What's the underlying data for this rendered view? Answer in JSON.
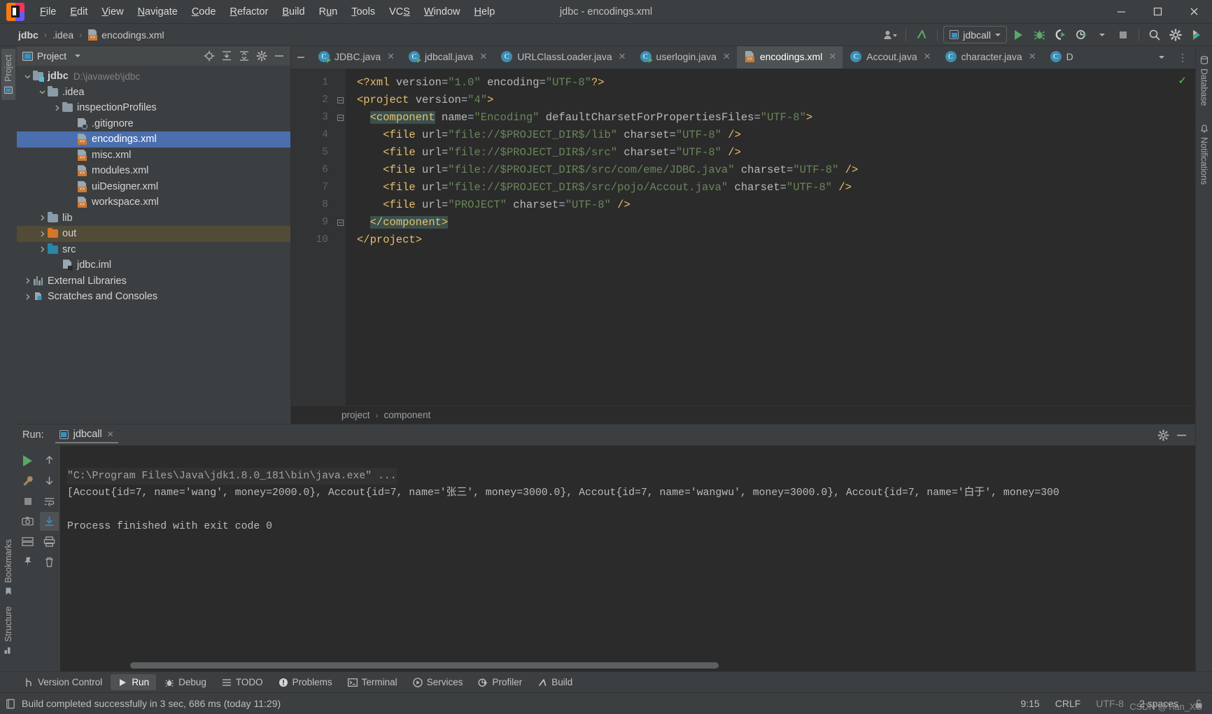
{
  "window": {
    "title": "jdbc - encodings.xml",
    "minimize": "─",
    "maximize": "☐",
    "close": "✕"
  },
  "menubar": {
    "items": [
      {
        "label": "File",
        "mnemonic": "F"
      },
      {
        "label": "Edit",
        "mnemonic": "E"
      },
      {
        "label": "View",
        "mnemonic": "V"
      },
      {
        "label": "Navigate",
        "mnemonic": "N"
      },
      {
        "label": "Code",
        "mnemonic": "C"
      },
      {
        "label": "Refactor",
        "mnemonic": "R"
      },
      {
        "label": "Build",
        "mnemonic": "B"
      },
      {
        "label": "Run",
        "mnemonic": "u"
      },
      {
        "label": "Tools",
        "mnemonic": "T"
      },
      {
        "label": "VCS",
        "mnemonic": "S"
      },
      {
        "label": "Window",
        "mnemonic": "W"
      },
      {
        "label": "Help",
        "mnemonic": "H"
      }
    ]
  },
  "navbar": {
    "breadcrumbs": [
      {
        "label": "jdbc",
        "bold": true
      },
      {
        "label": ".idea",
        "bold": false
      },
      {
        "label": "encodings.xml",
        "bold": false,
        "icon": "xml-file-icon"
      }
    ],
    "separator": "›",
    "run_configuration": "jdbcall",
    "actions": [
      "user-icon",
      "vcs-update-icon",
      "run-icon",
      "debug-icon",
      "run-with-coverage-icon",
      "profiler-icon",
      "stop-icon",
      "search-everywhere-icon",
      "settings-icon",
      "idea-assistant-icon"
    ]
  },
  "left_stripe": {
    "items": [
      {
        "label": "Project",
        "icon": "project-icon",
        "active": true
      },
      {
        "label": "Bookmarks",
        "icon": "bookmark-icon",
        "active": false
      },
      {
        "label": "Structure",
        "icon": "structure-icon",
        "active": false
      }
    ]
  },
  "right_stripe": {
    "items": [
      {
        "label": "Database",
        "icon": "database-icon"
      },
      {
        "label": "Notifications",
        "icon": "notifications-icon"
      }
    ]
  },
  "project_panel": {
    "title": "Project",
    "dropdown_caret": "▾",
    "header_actions": [
      "scroll-from-source-icon",
      "expand-all-icon",
      "collapse-all-icon",
      "gear-icon",
      "hide-icon"
    ],
    "tree": [
      {
        "label": "jdbc",
        "sub": "D:\\javaweb\\jdbc",
        "indent": 0,
        "arrow": "down",
        "icon": "module-folder-icon",
        "bold": true
      },
      {
        "label": ".idea",
        "indent": 1,
        "arrow": "down",
        "icon": "folder-icon"
      },
      {
        "label": "inspectionProfiles",
        "indent": 2,
        "arrow": "right",
        "icon": "folder-icon"
      },
      {
        "label": ".gitignore",
        "indent": 3,
        "arrow": "none",
        "icon": "gitignore-file-icon"
      },
      {
        "label": "encodings.xml",
        "indent": 3,
        "arrow": "none",
        "icon": "xml-file-icon",
        "selected": true
      },
      {
        "label": "misc.xml",
        "indent": 3,
        "arrow": "none",
        "icon": "xml-file-icon"
      },
      {
        "label": "modules.xml",
        "indent": 3,
        "arrow": "none",
        "icon": "xml-file-icon"
      },
      {
        "label": "uiDesigner.xml",
        "indent": 3,
        "arrow": "none",
        "icon": "xml-file-icon"
      },
      {
        "label": "workspace.xml",
        "indent": 3,
        "arrow": "none",
        "icon": "xml-file-icon"
      },
      {
        "label": "lib",
        "indent": 1,
        "arrow": "right",
        "icon": "folder-icon"
      },
      {
        "label": "out",
        "indent": 1,
        "arrow": "right",
        "icon": "folder-orange-icon",
        "highlighted": true
      },
      {
        "label": "src",
        "indent": 1,
        "arrow": "right",
        "icon": "folder-blue-icon"
      },
      {
        "label": "jdbc.iml",
        "indent": 2,
        "arrow": "none",
        "icon": "iml-file-icon"
      },
      {
        "label": "External Libraries",
        "indent": 0,
        "arrow": "right",
        "icon": "libraries-icon"
      },
      {
        "label": "Scratches and Consoles",
        "indent": 0,
        "arrow": "right",
        "icon": "scratches-icon"
      }
    ]
  },
  "editor": {
    "tabs": [
      {
        "label": "JDBC.java",
        "icon": "java-runnable-icon",
        "active": false,
        "closable": true
      },
      {
        "label": "jdbcall.java",
        "icon": "java-runnable-icon",
        "active": false,
        "closable": true
      },
      {
        "label": "URLClassLoader.java",
        "icon": "java-class-icon",
        "active": false,
        "closable": true,
        "readonly": true
      },
      {
        "label": "userlogin.java",
        "icon": "java-runnable-icon",
        "active": false,
        "closable": true
      },
      {
        "label": "encodings.xml",
        "icon": "xml-file-icon",
        "active": true,
        "closable": true
      },
      {
        "label": "Accout.java",
        "icon": "java-class-icon",
        "active": false,
        "closable": true
      },
      {
        "label": "character.java",
        "icon": "java-class-icon",
        "active": false,
        "closable": true
      },
      {
        "label": "D",
        "icon": "java-class-icon",
        "active": false,
        "closable": false
      }
    ],
    "tab_overflow_caret": "▾",
    "tab_more": "⋮",
    "line_numbers": [
      1,
      2,
      3,
      4,
      5,
      6,
      7,
      8,
      9,
      10
    ],
    "inspection_status": "✓",
    "breadcrumb": [
      "project",
      "component"
    ],
    "breadcrumb_sep": "›",
    "code_lines": [
      {
        "n": 1,
        "segments": [
          {
            "t": "<?xml ",
            "c": "meta"
          },
          {
            "t": "version",
            "c": "attr"
          },
          {
            "t": "=",
            "c": "eq"
          },
          {
            "t": "\"1.0\"",
            "c": "val"
          },
          {
            "t": " ",
            "c": "plain"
          },
          {
            "t": "encoding",
            "c": "attr"
          },
          {
            "t": "=",
            "c": "eq"
          },
          {
            "t": "\"UTF-8\"",
            "c": "val"
          },
          {
            "t": "?>",
            "c": "meta"
          }
        ]
      },
      {
        "n": 2,
        "segments": [
          {
            "t": "<project ",
            "c": "tag"
          },
          {
            "t": "version",
            "c": "attr"
          },
          {
            "t": "=",
            "c": "eq"
          },
          {
            "t": "\"4\"",
            "c": "val"
          },
          {
            "t": ">",
            "c": "tag"
          }
        ]
      },
      {
        "n": 3,
        "segments": [
          {
            "t": "  ",
            "c": "plain"
          },
          {
            "t": "<component",
            "c": "tag-hl"
          },
          {
            "t": " ",
            "c": "plain"
          },
          {
            "t": "name",
            "c": "attr"
          },
          {
            "t": "=",
            "c": "eq"
          },
          {
            "t": "\"Encoding\"",
            "c": "val"
          },
          {
            "t": " ",
            "c": "plain"
          },
          {
            "t": "defaultCharsetForPropertiesFiles",
            "c": "attr"
          },
          {
            "t": "=",
            "c": "eq"
          },
          {
            "t": "\"UTF-8\"",
            "c": "val"
          },
          {
            "t": ">",
            "c": "tag"
          }
        ]
      },
      {
        "n": 4,
        "segments": [
          {
            "t": "    ",
            "c": "plain"
          },
          {
            "t": "<file",
            "c": "tag"
          },
          {
            "t": " ",
            "c": "plain"
          },
          {
            "t": "url",
            "c": "attr"
          },
          {
            "t": "=",
            "c": "eq"
          },
          {
            "t": "\"file://$PROJECT_DIR$/lib\"",
            "c": "val"
          },
          {
            "t": " ",
            "c": "plain"
          },
          {
            "t": "charset",
            "c": "attr"
          },
          {
            "t": "=",
            "c": "eq"
          },
          {
            "t": "\"UTF-8\"",
            "c": "val"
          },
          {
            "t": " ",
            "c": "plain"
          },
          {
            "t": "/>",
            "c": "tag"
          }
        ]
      },
      {
        "n": 5,
        "segments": [
          {
            "t": "    ",
            "c": "plain"
          },
          {
            "t": "<file",
            "c": "tag"
          },
          {
            "t": " ",
            "c": "plain"
          },
          {
            "t": "url",
            "c": "attr"
          },
          {
            "t": "=",
            "c": "eq"
          },
          {
            "t": "\"file://$PROJECT_DIR$/src\"",
            "c": "val"
          },
          {
            "t": " ",
            "c": "plain"
          },
          {
            "t": "charset",
            "c": "attr"
          },
          {
            "t": "=",
            "c": "eq"
          },
          {
            "t": "\"UTF-8\"",
            "c": "val"
          },
          {
            "t": " ",
            "c": "plain"
          },
          {
            "t": "/>",
            "c": "tag"
          }
        ]
      },
      {
        "n": 6,
        "segments": [
          {
            "t": "    ",
            "c": "plain"
          },
          {
            "t": "<file",
            "c": "tag"
          },
          {
            "t": " ",
            "c": "plain"
          },
          {
            "t": "url",
            "c": "attr"
          },
          {
            "t": "=",
            "c": "eq"
          },
          {
            "t": "\"file://$PROJECT_DIR$/src/com/eme/JDBC.java\"",
            "c": "val"
          },
          {
            "t": " ",
            "c": "plain"
          },
          {
            "t": "charset",
            "c": "attr"
          },
          {
            "t": "=",
            "c": "eq"
          },
          {
            "t": "\"UTF-8\"",
            "c": "val"
          },
          {
            "t": " ",
            "c": "plain"
          },
          {
            "t": "/>",
            "c": "tag"
          }
        ]
      },
      {
        "n": 7,
        "segments": [
          {
            "t": "    ",
            "c": "plain"
          },
          {
            "t": "<file",
            "c": "tag"
          },
          {
            "t": " ",
            "c": "plain"
          },
          {
            "t": "url",
            "c": "attr"
          },
          {
            "t": "=",
            "c": "eq"
          },
          {
            "t": "\"file://$PROJECT_DIR$/src/pojo/Accout.java\"",
            "c": "val"
          },
          {
            "t": " ",
            "c": "plain"
          },
          {
            "t": "charset",
            "c": "attr"
          },
          {
            "t": "=",
            "c": "eq"
          },
          {
            "t": "\"UTF-8\"",
            "c": "val"
          },
          {
            "t": " ",
            "c": "plain"
          },
          {
            "t": "/>",
            "c": "tag"
          }
        ]
      },
      {
        "n": 8,
        "segments": [
          {
            "t": "    ",
            "c": "plain"
          },
          {
            "t": "<file",
            "c": "tag"
          },
          {
            "t": " ",
            "c": "plain"
          },
          {
            "t": "url",
            "c": "attr"
          },
          {
            "t": "=",
            "c": "eq"
          },
          {
            "t": "\"PROJECT\"",
            "c": "val"
          },
          {
            "t": " ",
            "c": "plain"
          },
          {
            "t": "charset",
            "c": "attr"
          },
          {
            "t": "=",
            "c": "eq"
          },
          {
            "t": "\"UTF-8\"",
            "c": "val"
          },
          {
            "t": " ",
            "c": "plain"
          },
          {
            "t": "/>",
            "c": "tag"
          }
        ]
      },
      {
        "n": 9,
        "segments": [
          {
            "t": "  ",
            "c": "plain"
          },
          {
            "t": "</component>",
            "c": "tag-hl"
          }
        ]
      },
      {
        "n": 10,
        "segments": [
          {
            "t": "</project>",
            "c": "tag"
          }
        ]
      }
    ]
  },
  "run_panel": {
    "label": "Run:",
    "tab": "jdbcall",
    "tab_close": "✕",
    "gear": "gear-icon",
    "hide": "─",
    "side_actions": [
      "rerun-icon",
      "up-stack-icon",
      "down-stack-icon",
      "wrench-icon",
      "stop-icon",
      "soft-wrap-icon",
      "scroll-to-end-icon",
      "camera-icon",
      "print-icon",
      "trash-icon"
    ],
    "console": {
      "command": "\"C:\\Program Files\\Java\\jdk1.8.0_181\\bin\\java.exe\" ...",
      "output": "[Accout{id=7, name='wang', money=2000.0}, Accout{id=7, name='张三', money=3000.0}, Accout{id=7, name='wangwu', money=3000.0}, Accout{id=7, name='白于', money=300",
      "exit": "Process finished with exit code 0"
    }
  },
  "tool_windows": {
    "items": [
      {
        "label": "Version Control",
        "icon": "branch-icon",
        "active": false
      },
      {
        "label": "Run",
        "icon": "play-icon",
        "active": true
      },
      {
        "label": "Debug",
        "icon": "bug-icon",
        "active": false
      },
      {
        "label": "TODO",
        "icon": "list-icon",
        "active": false
      },
      {
        "label": "Problems",
        "icon": "warning-icon",
        "active": false
      },
      {
        "label": "Terminal",
        "icon": "terminal-icon",
        "active": false
      },
      {
        "label": "Services",
        "icon": "services-icon",
        "active": false
      },
      {
        "label": "Profiler",
        "icon": "profiler-icon",
        "active": false
      },
      {
        "label": "Build",
        "icon": "build-icon",
        "active": false
      }
    ]
  },
  "statusbar": {
    "message": "Build completed successfully in 3 sec, 686 ms (today 11:29)",
    "message_icon": "build-status-icon",
    "caret_position": "9:15",
    "line_separator": "CRLF",
    "encoding": "UTF-8",
    "indent": "2 spaces",
    "lock_icon": "unlocked-icon",
    "watermark": "CSDN @Tian_XC"
  },
  "colors": {
    "accent_blue": "#4b6eaf",
    "green": "#59a869",
    "orange": "#cc7832",
    "string_green": "#6a8759",
    "tag_yellow": "#e8bf6a",
    "bg_dark": "#2b2b2b",
    "bg_panel": "#3c3f41"
  }
}
